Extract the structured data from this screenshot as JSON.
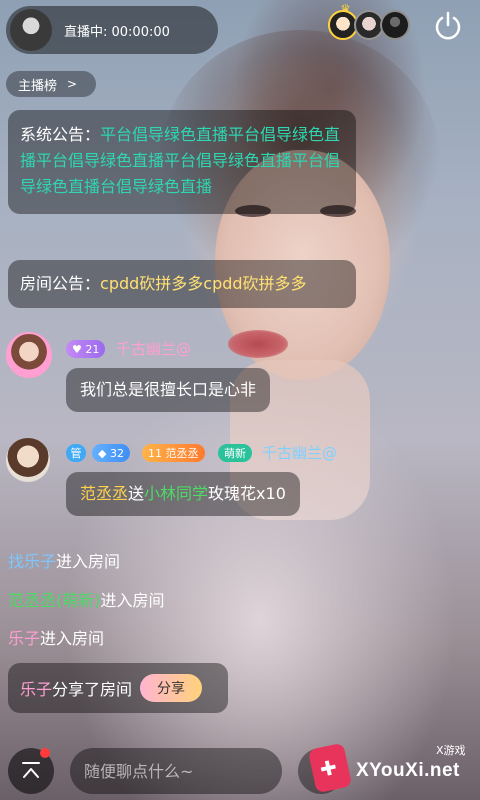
{
  "header": {
    "live_status": "直播中: 00:00:00",
    "rank_label": "主播榜",
    "rank_chevron": ">"
  },
  "notices": {
    "system_label": "系统公告：",
    "system_text": "平台倡导绿色直播平台倡导绿色直播平台倡导绿色直播平台倡导绿色直播平台倡导绿色直播台倡导绿色直播",
    "room_label": "房间公告：",
    "room_text": "cpdd砍拼多多cpdd砍拼多多"
  },
  "chat": {
    "msg1": {
      "level": "21",
      "name": "千古幽兰@",
      "text": "我们总是很擅长口是心非"
    },
    "msg2": {
      "badge_admin": "管",
      "level": "32",
      "fan_badge_level": "11",
      "fan_badge_name": "范丞丞",
      "new_badge": "萌新",
      "name": "千古幽兰@",
      "sender": "范丞丞",
      "verb": "送",
      "target": "小林同学",
      "gift": "玫瑰花x10"
    }
  },
  "system_messages": [
    {
      "name": "找乐子",
      "action": "进入房间"
    },
    {
      "name": "范丞丞(萌新)",
      "action": "进入房间"
    },
    {
      "name": "乐子",
      "action": "进入房间"
    }
  ],
  "share": {
    "name": "乐子",
    "action": "分享了房间",
    "button": "分享"
  },
  "bottom": {
    "chat_placeholder": "随便聊点什么~"
  },
  "watermark": {
    "site": "XYouXi.net",
    "tag": "X游戏"
  },
  "colors": {
    "notice_green": "#2ed6b2",
    "room_notice_yellow": "#ffe072",
    "username_pink": "#ff9fd2",
    "username_blue": "#7fd0ff"
  }
}
